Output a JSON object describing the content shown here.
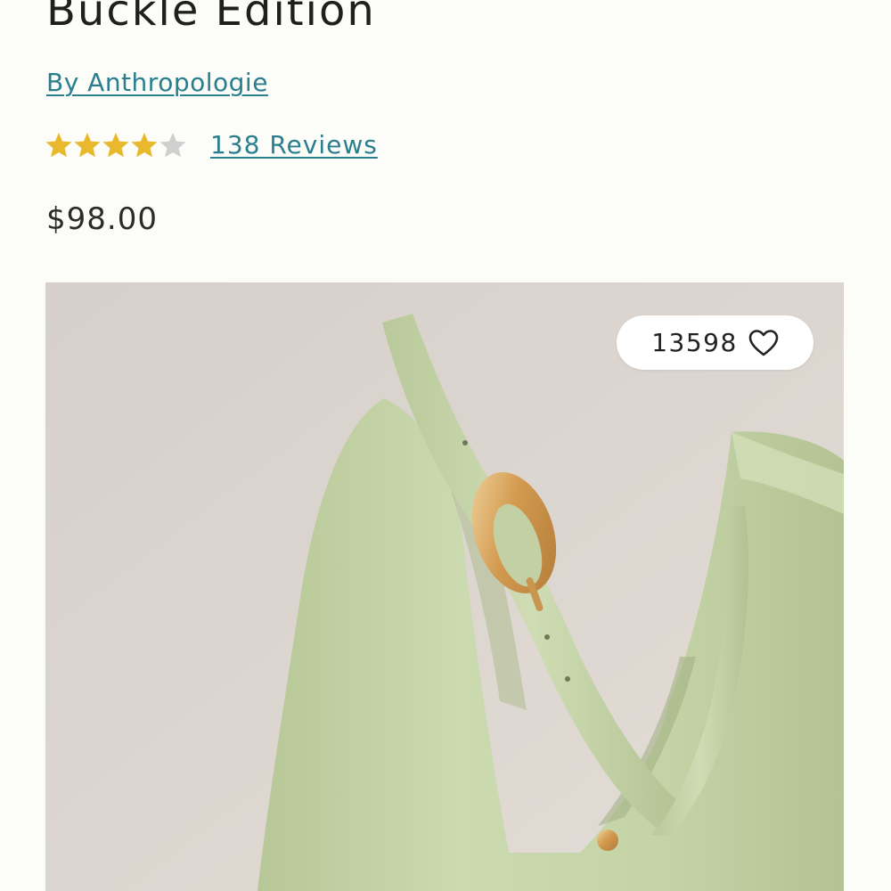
{
  "product": {
    "title": "Buckle Edition",
    "brand_link": "By Anthropologie",
    "rating": {
      "value": 4,
      "max": 5,
      "reviews_link": "138 Reviews"
    },
    "price": "$98.00",
    "likes": "13598"
  },
  "icons": {
    "like": "heart-outline-icon",
    "rating": "star-icon"
  },
  "colors": {
    "link": "#2a7f8f",
    "star_filled": "#e9b92d",
    "star_empty": "#cfcfcf",
    "bag": "#c6d5a8",
    "hardware": "#d9a85e"
  }
}
